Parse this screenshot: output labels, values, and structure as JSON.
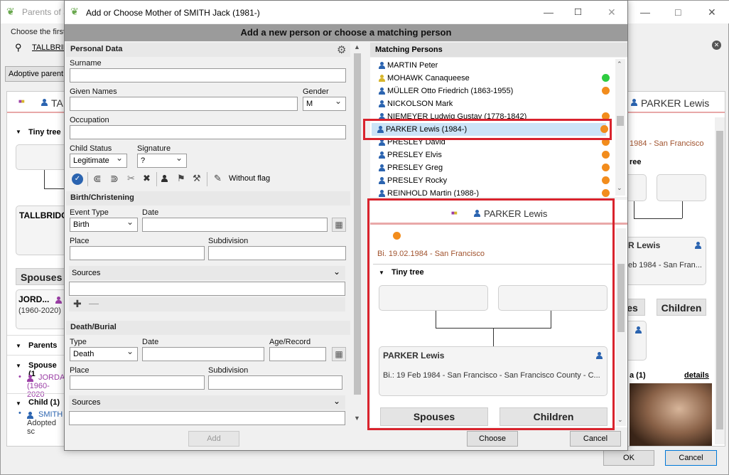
{
  "bg_window": {
    "title": "Parents of S",
    "choose_label": "Choose the first",
    "search_text": "TALLBRID",
    "adoptive_button": "Adoptive parent",
    "left_tab_text": "TAL",
    "tiny_tree_label": "Tiny tree",
    "tallbridge_text": "TALLBRIDG",
    "spouses_label": "Spouses",
    "spouse_card_name": "JORD...",
    "spouse_card_years": "(1960-2020)",
    "parents_label": "Parents",
    "spouse_section_label": "Spouse (1",
    "spouse_list_name": "JORDA",
    "spouse_list_years": "(1960-2020",
    "child_section_label": "Child (1)",
    "child_name": "SMITH",
    "child_note": "Adopted sc",
    "right_tab_name": "PARKER Lewis",
    "right_birth_snippet": "1984 - San Francisco",
    "right_tree_snippet": "ree",
    "right_card_name": "R Lewis",
    "right_card_date": "eb 1984 - San Fran...",
    "right_spouses_snippet": "es",
    "right_children_label": "Children",
    "right_bottom_label": "a (1)",
    "details_link": "details",
    "ok_button": "OK",
    "cancel_button": "Cancel"
  },
  "dialog": {
    "title": "Add or Choose Mother of SMITH Jack (1981-)",
    "banner": "Add a new person or choose a matching person",
    "personal_data_header": "Personal Data",
    "surname_label": "Surname",
    "surname_value": "",
    "given_names_label": "Given Names",
    "given_names_value": "",
    "gender_label": "Gender",
    "gender_value": "M",
    "occupation_label": "Occupation",
    "occupation_value": "",
    "child_status_label": "Child Status",
    "child_status_value": "Legitimate",
    "signature_label": "Signature",
    "signature_value": "?",
    "flag_text": "Without flag",
    "birth_header": "Birth/Christening",
    "birth_event_type_label": "Event Type",
    "birth_event_type_value": "Birth",
    "birth_date_label": "Date",
    "birth_place_label": "Place",
    "birth_subdivision_label": "Subdivision",
    "birth_sources_label": "Sources",
    "death_header": "Death/Burial",
    "death_type_label": "Type",
    "death_type_value": "Death",
    "death_date_label": "Date",
    "death_age_label": "Age/Record",
    "death_place_label": "Place",
    "death_subdivision_label": "Subdivision",
    "death_sources_label": "Sources",
    "add_button": "Add",
    "choose_button": "Choose",
    "cancel_button": "Cancel",
    "matching_header": "Matching Persons",
    "matches": [
      {
        "name": "MARTIN Peter",
        "gender": "m",
        "dot": ""
      },
      {
        "name": "MOHAWK Canaqueese",
        "gender": "y",
        "dot": "#2ecc40"
      },
      {
        "name": "MÜLLER Otto Friedrich (1863-1955)",
        "gender": "m",
        "dot": "#f28c1c"
      },
      {
        "name": "NICKOLSON Mark",
        "gender": "m",
        "dot": ""
      },
      {
        "name": "NIEMEYER Ludwig Gustav (1778-1842)",
        "gender": "m",
        "dot": "#f28c1c"
      },
      {
        "name": "PARKER Lewis (1984-)",
        "gender": "m",
        "dot": "#f28c1c"
      },
      {
        "name": "PRESLEY David",
        "gender": "m",
        "dot": "#f28c1c"
      },
      {
        "name": "PRESLEY Elvis",
        "gender": "m",
        "dot": "#f28c1c"
      },
      {
        "name": "PRESLEY Greg",
        "gender": "m",
        "dot": "#f28c1c"
      },
      {
        "name": "PRESLEY Rocky",
        "gender": "m",
        "dot": "#f28c1c"
      },
      {
        "name": "REINHOLD Martin (1988-)",
        "gender": "m",
        "dot": "#f28c1c"
      }
    ],
    "preview": {
      "name": "PARKER Lewis",
      "birth_line": "Bi.  19.02.1984 - San Francisco",
      "tiny_tree_label": "Tiny tree",
      "card_name": "PARKER Lewis",
      "card_line": "Bi.: 19 Feb 1984 - San Francisco - San Francisco County - C...",
      "spouses_button": "Spouses",
      "children_button": "Children"
    }
  },
  "colors": {
    "highlight_red": "#d9232d",
    "selected_row": "#cce4f7",
    "dot_orange": "#f28c1c",
    "dot_green": "#2ecc40"
  }
}
